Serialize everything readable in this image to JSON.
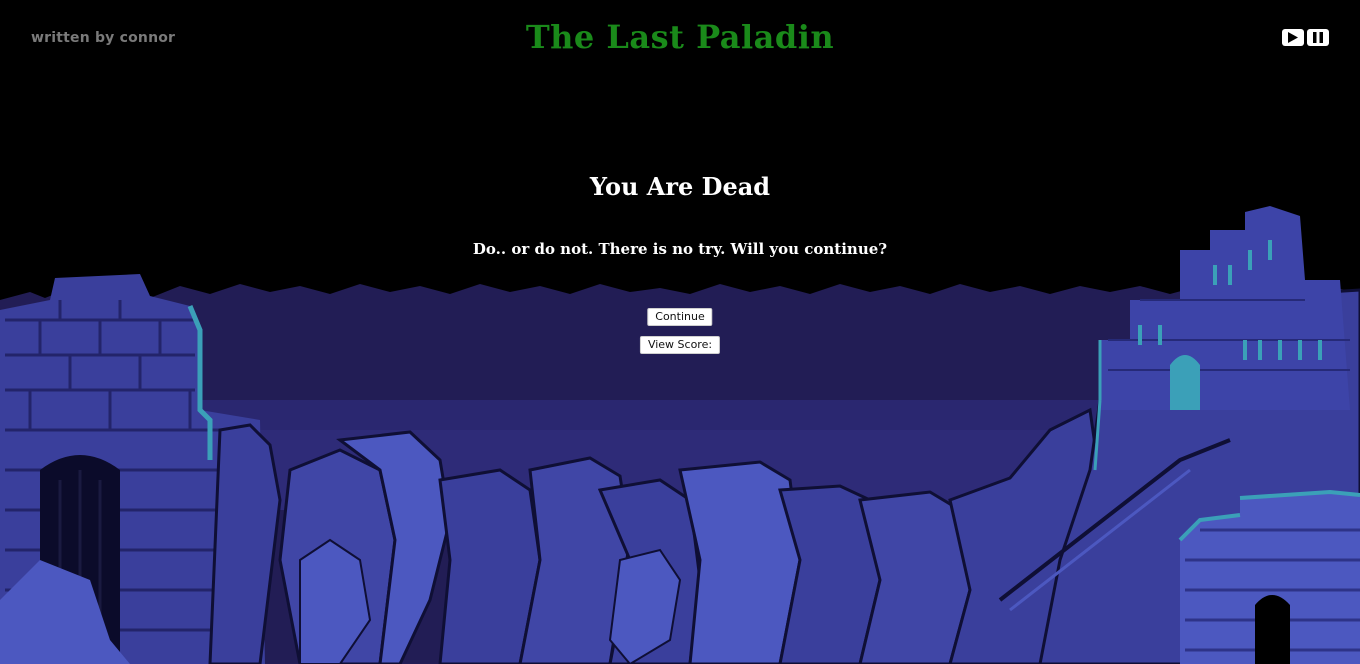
{
  "header": {
    "author": "written by connor",
    "title": "The Last Paladin"
  },
  "controls": {
    "play_icon": "play-icon",
    "pause_icon": "pause-icon"
  },
  "death_screen": {
    "heading": "You Are Dead",
    "message": "Do.. or do not. There is no try. Will you continue?",
    "continue_label": "Continue",
    "score_label": "View Score:"
  },
  "colors": {
    "background": "#000000",
    "title": "#1a8a1a",
    "author": "#7a7a7a",
    "sky": "#221d55",
    "rock": "#3a3f9c",
    "rock_highlight": "#4c58c0",
    "accent": "#3ba0b8"
  }
}
